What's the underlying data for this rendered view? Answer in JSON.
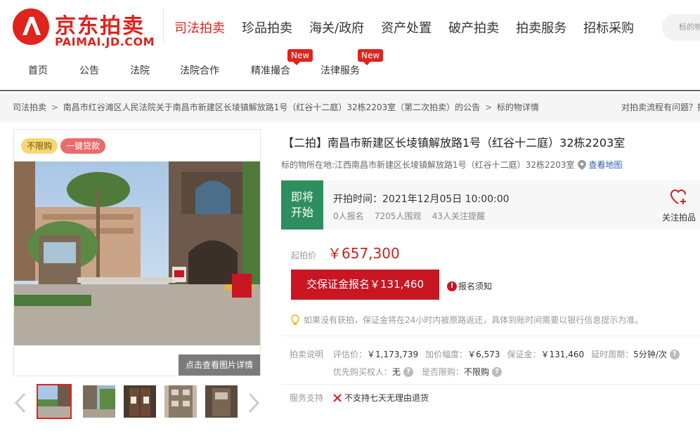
{
  "brand": {
    "name_cn": "京东拍卖",
    "name_en": "PAIMAI.JD.COM",
    "color": "#e0231c"
  },
  "main_nav": [
    {
      "label": "司法拍卖",
      "active": true
    },
    {
      "label": "珍品拍卖"
    },
    {
      "label": "海关/政府"
    },
    {
      "label": "资产处置"
    },
    {
      "label": "破产拍卖"
    },
    {
      "label": "拍卖服务"
    },
    {
      "label": "招标采购"
    }
  ],
  "search": {
    "placeholder": "标的物"
  },
  "sub_nav": [
    {
      "label": "首页"
    },
    {
      "label": "公告"
    },
    {
      "label": "法院"
    },
    {
      "label": "法院合作"
    },
    {
      "label": "精准撮合",
      "badge": "New"
    },
    {
      "label": "法律服务",
      "badge": "New"
    }
  ],
  "breadcrumb": {
    "items": [
      "司法拍卖",
      "南昌市红谷滩区人民法院关于南昌市新建区长堎镇解放路1号（红谷十二庭）32栋2203室（第二次拍卖）的公告",
      "标的物详情"
    ],
    "separator": ">",
    "help": "对拍卖流程有问题？拍"
  },
  "gallery": {
    "tags": [
      "不限购",
      "一键贷款"
    ],
    "detail_button": "点击查看图片详情",
    "thumb_count": 5
  },
  "lot": {
    "title": "【二拍】南昌市新建区长堎镇解放路1号（红谷十二庭）32栋2203室",
    "location_label": "标的物所在地:",
    "location": "江西南昌市新建区长堎镇解放路1号（红谷十二庭）32栋2203室",
    "map_link": "查看地图"
  },
  "status": {
    "label_line1": "即将",
    "label_line2": "开始",
    "start_time": "开拍时间：2021年12月05日 10:00:00",
    "counts": "0人报名    7205人围观    43人关注提醒",
    "follow_label": "关注拍品",
    "color": "#2e8f5e"
  },
  "price": {
    "label": "起拍价",
    "value": "￥657,300",
    "deposit_button": "交保证金报名￥131,460",
    "notice": "报名须知",
    "refund_tip": "如果没有获拍，保证金将在24小时内被原路返还，具体到账时间需要以银行信息提示为准。"
  },
  "auction_info": {
    "label": "拍卖说明",
    "row1": [
      {
        "k": "评估价：",
        "v": "￥1,173,739"
      },
      {
        "k": "加价幅度：",
        "v": "￥6,573"
      },
      {
        "k": "保证金：",
        "v": "￥131,460"
      },
      {
        "k": "延时周期：",
        "v": "5分钟/次"
      }
    ],
    "row2": [
      {
        "k": "优先购买权人：",
        "v": "无"
      },
      {
        "k": "是否限购：",
        "v": "不限购"
      }
    ]
  },
  "service": {
    "label": "服务支持",
    "value": "不支持七天无理由退货"
  }
}
